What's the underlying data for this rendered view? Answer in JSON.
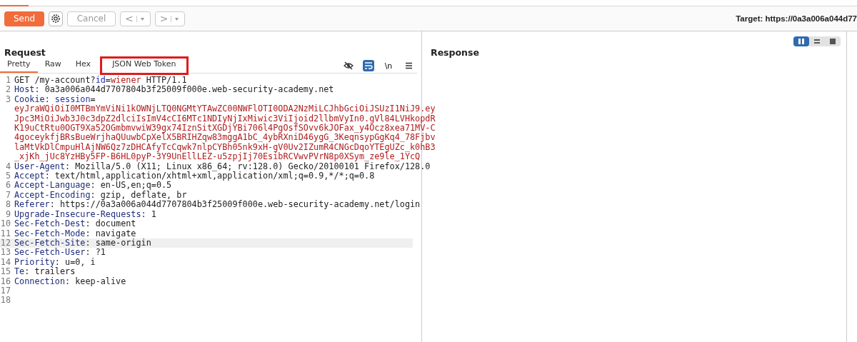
{
  "toolbar": {
    "send": "Send",
    "cancel": "Cancel",
    "back": "<",
    "forward": ">",
    "target": "Target: https://0a3a006a044d77"
  },
  "request": {
    "title": "Request",
    "tabs": [
      {
        "label": "Pretty",
        "selected": true,
        "annotated": false
      },
      {
        "label": "Raw",
        "selected": false,
        "annotated": false
      },
      {
        "label": "Hex",
        "selected": false,
        "annotated": false
      },
      {
        "label": "JSON Web Token",
        "selected": false,
        "annotated": true
      }
    ],
    "newline_toggle": "\\n",
    "lines": [
      {
        "number": "1",
        "highlighted": false,
        "segments": [
          {
            "kind": "plain",
            "text": "GET /my-account?"
          },
          {
            "kind": "param",
            "text": "id"
          },
          {
            "kind": "plain",
            "text": "="
          },
          {
            "kind": "value",
            "text": "wiener"
          },
          {
            "kind": "plain",
            "text": " HTTP/1.1"
          }
        ]
      },
      {
        "number": "2",
        "highlighted": false,
        "segments": [
          {
            "kind": "header",
            "text": "Host"
          },
          {
            "kind": "plain",
            "text": ": 0a3a006a044d7707804b3f25009f000e.web-security-academy.net"
          }
        ]
      },
      {
        "number": "3",
        "highlighted": false,
        "segments": [
          {
            "kind": "header",
            "text": "Cookie"
          },
          {
            "kind": "plain",
            "text": ": "
          },
          {
            "kind": "param",
            "text": "session"
          },
          {
            "kind": "plain",
            "text": "="
          }
        ]
      },
      {
        "highlighted": false,
        "segments": [
          {
            "kind": "value",
            "text": "eyJraWQiOiI0MTBmYmViNi1kOWNjLTQ0NGMtYTAwZC00NWFlOTI0ODA2NzMiLCJhbGciOiJSUzI1NiJ9.ey"
          }
        ]
      },
      {
        "highlighted": false,
        "segments": [
          {
            "kind": "value",
            "text": "Jpc3MiOiJwb3J0c3dpZ2dlciIsImV4cCI6MTc1NDIyNjIxMiwic3ViIjoid2llbmVyIn0.gVl84LVHkopdR"
          }
        ]
      },
      {
        "highlighted": false,
        "segments": [
          {
            "kind": "value",
            "text": "K19uCtRtu0OGT9Xa52OGmbmvwiW39gx74IznSitXGDjYBi706l4PgOsfSOvv6kJOFax_y4Ocz8xea71MV-C"
          }
        ]
      },
      {
        "highlighted": false,
        "segments": [
          {
            "kind": "value",
            "text": "4goceykfjBRsBueWrjhaQUuwbCpXelX5BRIHZqw83mggA1bC_4ybRXniD46ygG_3KeqnsypGgKq4_78Fjbv"
          }
        ]
      },
      {
        "highlighted": false,
        "segments": [
          {
            "kind": "value",
            "text": "laMtVkDlCmpuHlAjNW6Qz7zDHCAfyTcCqwk7nlpCYBh05nk9xH-gV0Uv2IZumR4CNGcDqoYTEgUZc_k0hB3"
          }
        ]
      },
      {
        "highlighted": false,
        "segments": [
          {
            "kind": "value",
            "text": "_xjKh_jUc8YzHBy5FP-B6HL0pyP-3Y9UnEllLEZ-u5zpjIj70EsibRCVwvPVrN8p0XSym_ze9le_1YcQ"
          }
        ]
      },
      {
        "number": "4",
        "highlighted": false,
        "segments": [
          {
            "kind": "header",
            "text": "User-Agent"
          },
          {
            "kind": "plain",
            "text": ": Mozilla/5.0 (X11; Linux x86_64; rv:128.0) Gecko/20100101 Firefox/128.0"
          }
        ]
      },
      {
        "number": "5",
        "highlighted": false,
        "segments": [
          {
            "kind": "header",
            "text": "Accept"
          },
          {
            "kind": "plain",
            "text": ": text/html,application/xhtml+xml,application/xml;q=0.9,*/*;q=0.8"
          }
        ]
      },
      {
        "number": "6",
        "highlighted": false,
        "segments": [
          {
            "kind": "header",
            "text": "Accept-Language"
          },
          {
            "kind": "plain",
            "text": ": en-US,en;q=0.5"
          }
        ]
      },
      {
        "number": "7",
        "highlighted": false,
        "segments": [
          {
            "kind": "header",
            "text": "Accept-Encoding"
          },
          {
            "kind": "plain",
            "text": ": gzip, deflate, br"
          }
        ]
      },
      {
        "number": "8",
        "highlighted": false,
        "segments": [
          {
            "kind": "header",
            "text": "Referer"
          },
          {
            "kind": "plain",
            "text": ": https://0a3a006a044d7707804b3f25009f000e.web-security-academy.net/login"
          }
        ]
      },
      {
        "number": "9",
        "highlighted": false,
        "segments": [
          {
            "kind": "header",
            "text": "Upgrade-Insecure-Requests"
          },
          {
            "kind": "plain",
            "text": ": 1"
          }
        ]
      },
      {
        "number": "10",
        "highlighted": false,
        "segments": [
          {
            "kind": "header",
            "text": "Sec-Fetch-Dest"
          },
          {
            "kind": "plain",
            "text": ": document"
          }
        ]
      },
      {
        "number": "11",
        "highlighted": false,
        "segments": [
          {
            "kind": "header",
            "text": "Sec-Fetch-Mode"
          },
          {
            "kind": "plain",
            "text": ": navigate"
          }
        ]
      },
      {
        "number": "12",
        "highlighted": true,
        "segments": [
          {
            "kind": "header",
            "text": "Sec-Fetch-Site"
          },
          {
            "kind": "plain",
            "text": ": same-origin"
          }
        ]
      },
      {
        "number": "13",
        "highlighted": false,
        "segments": [
          {
            "kind": "header",
            "text": "Sec-Fetch-User"
          },
          {
            "kind": "plain",
            "text": ": ?1"
          }
        ]
      },
      {
        "number": "14",
        "highlighted": false,
        "segments": [
          {
            "kind": "header",
            "text": "Priority"
          },
          {
            "kind": "plain",
            "text": ": u=0, i"
          }
        ]
      },
      {
        "number": "15",
        "highlighted": false,
        "segments": [
          {
            "kind": "header",
            "text": "Te"
          },
          {
            "kind": "plain",
            "text": ": trailers"
          }
        ]
      },
      {
        "number": "16",
        "highlighted": false,
        "segments": [
          {
            "kind": "header",
            "text": "Connection"
          },
          {
            "kind": "plain",
            "text": ": keep-alive"
          }
        ]
      },
      {
        "number": "17",
        "highlighted": false
      },
      {
        "number": "18",
        "highlighted": false
      }
    ]
  },
  "response": {
    "title": "Response"
  },
  "layout_modes": [
    {
      "selected": true
    },
    {
      "selected": false
    },
    {
      "selected": false
    }
  ]
}
